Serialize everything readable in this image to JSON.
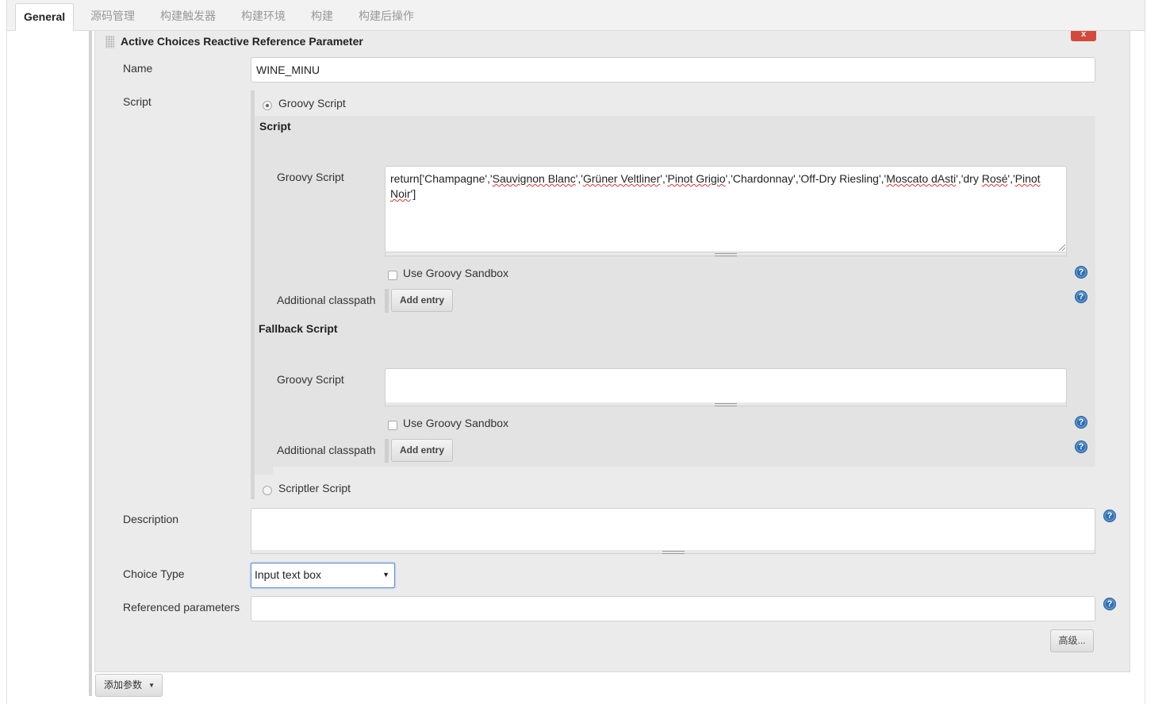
{
  "tabs": [
    {
      "label": "General",
      "active": true
    },
    {
      "label": "源码管理"
    },
    {
      "label": "构建触发器"
    },
    {
      "label": "构建环境"
    },
    {
      "label": "构建"
    },
    {
      "label": "构建后操作"
    }
  ],
  "parameter": {
    "title": "Active Choices Reactive Reference Parameter",
    "delete_label": "x",
    "name_label": "Name",
    "name_value": "WINE_MINU",
    "script_label": "Script",
    "groovy_option": "Groovy Script",
    "scriptler_option": "Scriptler Script",
    "script_section": {
      "heading": "Script",
      "groovy_label": "Groovy Script",
      "groovy_code_parts": [
        "return['Champagne','",
        "Sauvignon Blanc",
        "','",
        "Grüner Veltliner",
        "','",
        "Pinot Grigio",
        "','Chardonnay','Off-Dry Riesling','",
        "Moscato dAsti",
        "','dry ",
        "Rosé",
        "','",
        "Pinot",
        " ",
        "Noir",
        "']"
      ],
      "sandbox_label": "Use Groovy Sandbox",
      "classpath_label": "Additional classpath",
      "add_entry": "Add entry"
    },
    "fallback_section": {
      "heading": "Fallback Script",
      "groovy_label": "Groovy Script",
      "groovy_code": "",
      "sandbox_label": "Use Groovy Sandbox",
      "classpath_label": "Additional classpath",
      "add_entry": "Add entry"
    },
    "description_label": "Description",
    "description_value": "",
    "choice_type_label": "Choice Type",
    "choice_type_value": "Input text box",
    "referenced_label": "Referenced parameters",
    "referenced_value": "",
    "advanced_button": "高级...",
    "help_icon_text": "?"
  },
  "add_param_button": "添加参数",
  "colors": {
    "delete_button": "#d24a3c",
    "help_icon": "#2f6fb0",
    "panel_bg": "#ebebeb"
  }
}
